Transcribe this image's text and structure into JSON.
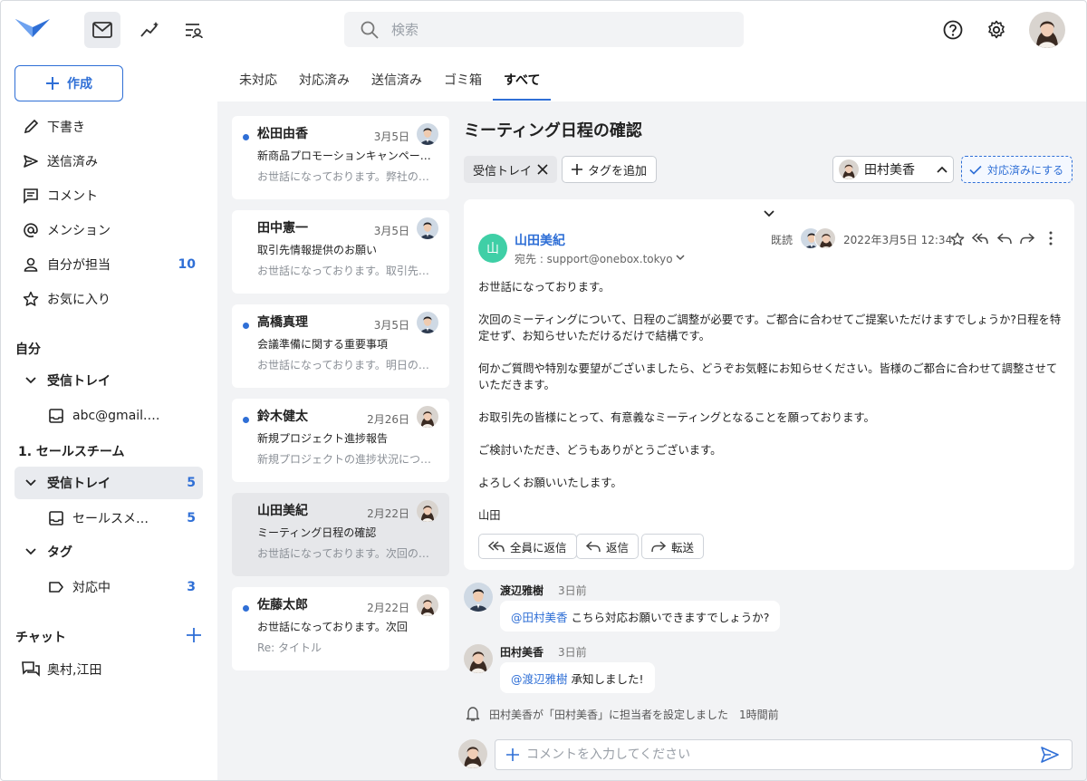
{
  "colors": {
    "accent": "#2f6fd6",
    "unread_dot": "#2f6fd6",
    "sender_avatar": "#3fcfa6",
    "panel_bg": "#f2f3f5"
  },
  "search": {
    "placeholder": "検索"
  },
  "sidebar": {
    "compose_label": "作成",
    "items": [
      {
        "label": "下書き",
        "icon": "pencil-icon"
      },
      {
        "label": "送信済み",
        "icon": "send-icon"
      },
      {
        "label": "コメント",
        "icon": "comment-icon"
      },
      {
        "label": "メンション",
        "icon": "at-icon"
      },
      {
        "label": "自分が担当",
        "icon": "person-icon",
        "count": "10"
      },
      {
        "label": "お気に入り",
        "icon": "star-icon"
      }
    ],
    "self_section": "自分",
    "self_inbox": "受信トレイ",
    "self_account": "abc@gmail.…",
    "team_section": "1. セールスチーム",
    "team_inbox": "受信トレイ",
    "team_inbox_count": "5",
    "team_account": "セールスメ…",
    "team_account_count": "5",
    "tag_section": "タグ",
    "tag_item": "対応中",
    "tag_item_count": "3",
    "chat_section": "チャット",
    "chat_item": "奥村,江田"
  },
  "tabs": [
    "未対応",
    "対応済み",
    "送信済み",
    "ゴミ箱",
    "すべて"
  ],
  "messages": [
    {
      "name": "松田由香",
      "date": "3月5日",
      "subject": "新商品プロモーションキャンペー…",
      "preview": "お世話になっております。弊社の…",
      "unread": true
    },
    {
      "name": "田中憲一",
      "date": "3月5日",
      "subject": "取引先情報提供のお願い",
      "preview": "お世話になっております。取引先…",
      "unread": false
    },
    {
      "name": "高橋真理",
      "date": "3月5日",
      "subject": "会議準備に関する重要事項",
      "preview": "お世話になっております。明日の…",
      "unread": true
    },
    {
      "name": "鈴木健太",
      "date": "2月26日",
      "subject": "新規プロジェクト進捗報告",
      "preview": "新規プロジェクトの進捗状況につ…",
      "unread": true
    },
    {
      "name": "山田美紀",
      "date": "2月22日",
      "subject": "ミーティング日程の確認",
      "preview": "お世話になっております。次回の…",
      "unread": false
    },
    {
      "name": "佐藤太郎",
      "date": "2月22日",
      "subject": "お世話になっております。次回",
      "preview": "Re: タイトル",
      "unread": true
    }
  ],
  "detail": {
    "title": "ミーティング日程の確認",
    "tag_chip": "受信トレイ",
    "add_tag": "タグを追加",
    "assignee": "田村美香",
    "mark_done": "対応済みにする",
    "sender_initial": "山",
    "sender": "山田美紀",
    "to": "宛先 : support@onebox.tokyo",
    "read_label": "既読",
    "datetime": "2022年3月5日 12:34",
    "body": [
      "お世話になっております。",
      "次回のミーティングについて、日程のご調整が必要です。ご都合に合わせてご提案いただけますでしょうか?日程を特定せず、お知らせいただけるだけで結構です。",
      "何かご質問や特別な要望がございましたら、どうぞお気軽にお知らせください。皆様のご都合に合わせて調整させていただきます。",
      "お取引先の皆様にとって、有意義なミーティングとなることを願っております。",
      "ご検討いただき、どうもありがとうございます。",
      "よろしくお願いいたします。",
      "山田"
    ],
    "reply_all": "全員に返信",
    "reply": "返信",
    "forward": "転送"
  },
  "comments": [
    {
      "name": "渡辺雅樹",
      "time": "3日前",
      "mention": "@田村美香",
      "text": "こちら対応お願いできますでしょうか?"
    },
    {
      "name": "田村美香",
      "time": "3日前",
      "mention": "@渡辺雅樹",
      "text": "承知しました!"
    }
  ],
  "activity": "田村美香が「田村美香」に担当者を設定しました　1時間前",
  "composer": {
    "placeholder": "コメントを入力してください"
  }
}
